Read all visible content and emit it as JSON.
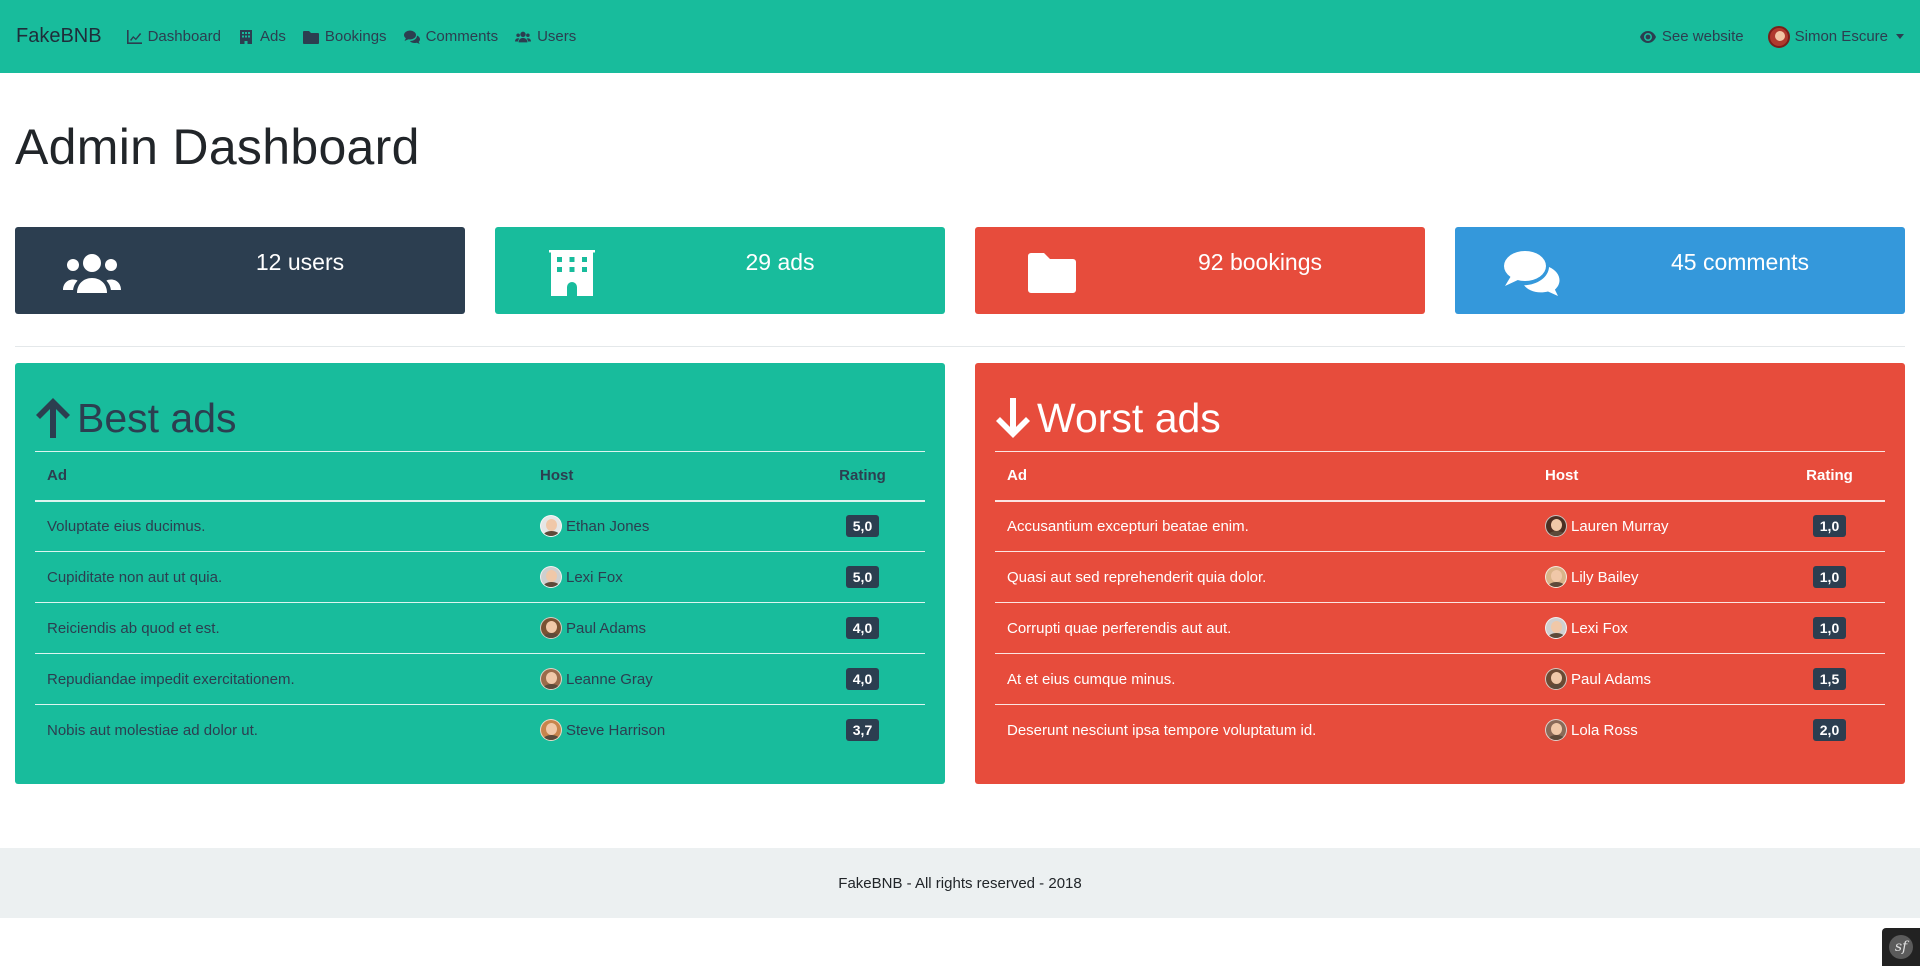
{
  "navbar": {
    "brand": "FakeBNB",
    "links": [
      {
        "label": "Dashboard",
        "icon": "chart-line-icon"
      },
      {
        "label": "Ads",
        "icon": "building-icon"
      },
      {
        "label": "Bookings",
        "icon": "folder-icon"
      },
      {
        "label": "Comments",
        "icon": "comments-icon"
      },
      {
        "label": "Users",
        "icon": "users-icon"
      }
    ],
    "see_website": "See website",
    "user_name": "Simon Escure"
  },
  "page_title": "Admin Dashboard",
  "stats": [
    {
      "text": "12 users",
      "icon": "users-icon",
      "color": "#2c3e50"
    },
    {
      "text": "29 ads",
      "icon": "building-icon",
      "color": "#18bc9c"
    },
    {
      "text": "92 bookings",
      "icon": "folder-icon",
      "color": "#e74c3c"
    },
    {
      "text": "45 comments",
      "icon": "comments-icon",
      "color": "#3498db"
    }
  ],
  "best_ads": {
    "title": "Best ads",
    "columns": [
      "Ad",
      "Host",
      "Rating"
    ],
    "rows": [
      {
        "ad": "Voluptate eius ducimus.",
        "host": "Ethan Jones",
        "rating": "5,0"
      },
      {
        "ad": "Cupiditate non aut ut quia.",
        "host": "Lexi Fox",
        "rating": "5,0"
      },
      {
        "ad": "Reiciendis ab quod et est.",
        "host": "Paul Adams",
        "rating": "4,0"
      },
      {
        "ad": "Repudiandae impedit exercitationem.",
        "host": "Leanne Gray",
        "rating": "4,0"
      },
      {
        "ad": "Nobis aut molestiae ad dolor ut.",
        "host": "Steve Harrison",
        "rating": "3,7"
      }
    ]
  },
  "worst_ads": {
    "title": "Worst ads",
    "columns": [
      "Ad",
      "Host",
      "Rating"
    ],
    "rows": [
      {
        "ad": "Accusantium excepturi beatae enim.",
        "host": "Lauren Murray",
        "rating": "1,0"
      },
      {
        "ad": "Quasi aut sed reprehenderit quia dolor.",
        "host": "Lily Bailey",
        "rating": "1,0"
      },
      {
        "ad": "Corrupti quae perferendis aut aut.",
        "host": "Lexi Fox",
        "rating": "1,0"
      },
      {
        "ad": "At et eius cumque minus.",
        "host": "Paul Adams",
        "rating": "1,5"
      },
      {
        "ad": "Deserunt nesciunt ipsa tempore voluptatum id.",
        "host": "Lola Ross",
        "rating": "2,0"
      }
    ]
  },
  "footer": "FakeBNB - All rights reserved - 2018",
  "colors": {
    "primary": "#2c3e50",
    "success": "#18bc9c",
    "danger": "#e74c3c",
    "info": "#3498db"
  }
}
